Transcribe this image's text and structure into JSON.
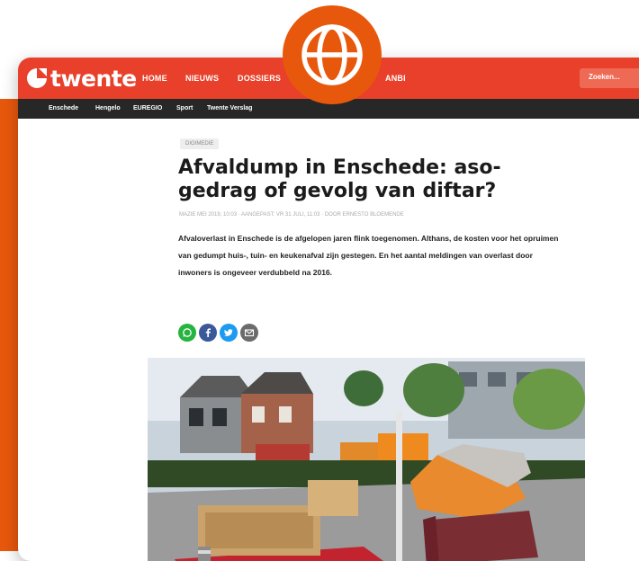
{
  "brand": {
    "name": "twente",
    "accent": "#e8580c",
    "nav_color": "#e8402a"
  },
  "nav": {
    "items": [
      "HOME",
      "NIEUWS",
      "DOSSIERS",
      "ANBI"
    ]
  },
  "search": {
    "placeholder": "Zoeken..."
  },
  "subnav": {
    "items": [
      "Enschede",
      "Hengelo",
      "EUREGIO",
      "Sport",
      "Twente Verslag"
    ]
  },
  "article": {
    "category": "DIGIMEDIE",
    "title": "Afvaldump in Enschede: aso-gedrag of gevolg van diftar?",
    "meta": "MAZIE MEI 2019, 10:03 · AANGEPAST: VR 31 JULI, 11:03 · DOOR ERNESTO BLOEMENDE",
    "lead": "Afvaloverlast in Enschede is de afgelopen jaren flink toegenomen. Althans, de kosten voor het opruimen van gedumpt huis-, tuin- en keukenafval zijn gestegen. En het aantal meldingen van overlast door inwoners is ongeveer verdubbeld na 2016."
  },
  "share": [
    "whatsapp-icon",
    "facebook-icon",
    "twitter-icon",
    "email-icon"
  ],
  "badge": {
    "icon": "globe-icon"
  },
  "photo": {
    "subject": "dumped furniture on a street corner"
  }
}
